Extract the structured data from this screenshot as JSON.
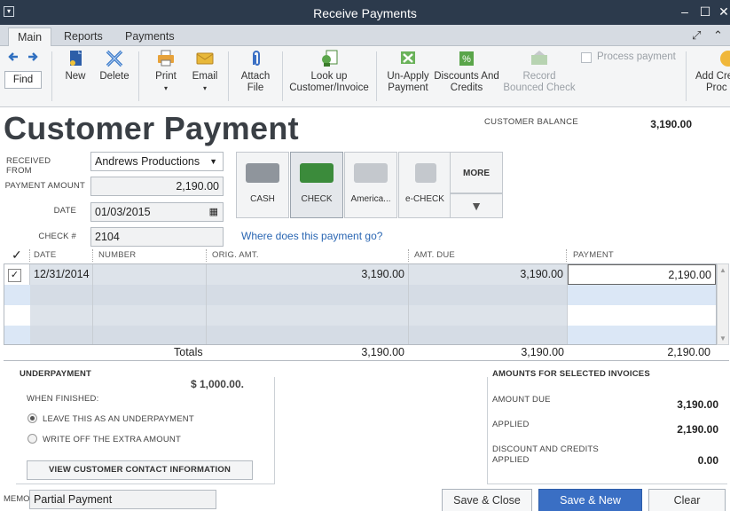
{
  "window": {
    "title": "Receive Payments"
  },
  "tabs": [
    "Main",
    "Reports",
    "Payments"
  ],
  "toolbar": {
    "find": "Find",
    "new": "New",
    "delete": "Delete",
    "print": "Print",
    "email": "Email",
    "attach_1": "Attach",
    "attach_2": "File",
    "lookup_1": "Look up",
    "lookup_2": "Customer/Invoice",
    "unapply_1": "Un-Apply",
    "unapply_2": "Payment",
    "discounts_1": "Discounts And",
    "discounts_2": "Credits",
    "record_1": "Record",
    "record_2": "Bounced Check",
    "process_payment": "Process payment",
    "addcredit_1": "Add Cre",
    "addcredit_2": "Proc"
  },
  "header": {
    "title": "Customer Payment",
    "customer_balance_label": "CUSTOMER BALANCE",
    "customer_balance": "3,190.00"
  },
  "form": {
    "received_from_label": "RECEIVED FROM",
    "received_from": "Andrews Productions",
    "payment_amount_label": "PAYMENT AMOUNT",
    "payment_amount": "2,190.00",
    "date_label": "DATE",
    "date": "01/03/2015",
    "check_label": "CHECK #",
    "check_no": "2104"
  },
  "payment_methods": {
    "cash": "CASH",
    "check": "CHECK",
    "amex": "America...",
    "echeck": "e-CHECK",
    "more": "MORE",
    "selected": "CHECK"
  },
  "where_link": "Where does this payment go?",
  "grid": {
    "headers": {
      "check": "✓",
      "date": "DATE",
      "number": "NUMBER",
      "orig_amt": "ORIG. AMT.",
      "amt_due": "AMT. DUE",
      "payment": "PAYMENT"
    },
    "rows": [
      {
        "checked": "✓",
        "date": "12/31/2014",
        "number": "",
        "orig_amt": "3,190.00",
        "amt_due": "3,190.00",
        "payment": "2,190.00"
      }
    ],
    "totals": {
      "label": "Totals",
      "orig_amt": "3,190.00",
      "amt_due": "3,190.00",
      "payment": "2,190.00"
    }
  },
  "underpayment": {
    "title": "UNDERPAYMENT",
    "amount": "$ 1,000.00.",
    "when_finished": "WHEN FINISHED:",
    "option_leave": "LEAVE THIS AS AN UNDERPAYMENT",
    "option_writeoff": "WRITE OFF THE EXTRA AMOUNT",
    "view_contact": "VIEW CUSTOMER CONTACT INFORMATION"
  },
  "amounts": {
    "title": "AMOUNTS FOR SELECTED INVOICES",
    "amount_due_label": "AMOUNT DUE",
    "amount_due": "3,190.00",
    "applied_label": "APPLIED",
    "applied": "2,190.00",
    "discount_label_1": "DISCOUNT AND CREDITS",
    "discount_label_2": "APPLIED",
    "discount": "0.00"
  },
  "footer": {
    "memo_label": "MEMO",
    "memo": "Partial Payment",
    "save_close": "Save & Close",
    "save_new": "Save & New",
    "clear": "Clear"
  },
  "colors": {
    "titlebar": "#2c3a4c",
    "primary_button": "#3a6fc4",
    "link": "#2b67b3",
    "selected_row": "#dbe4f0"
  }
}
